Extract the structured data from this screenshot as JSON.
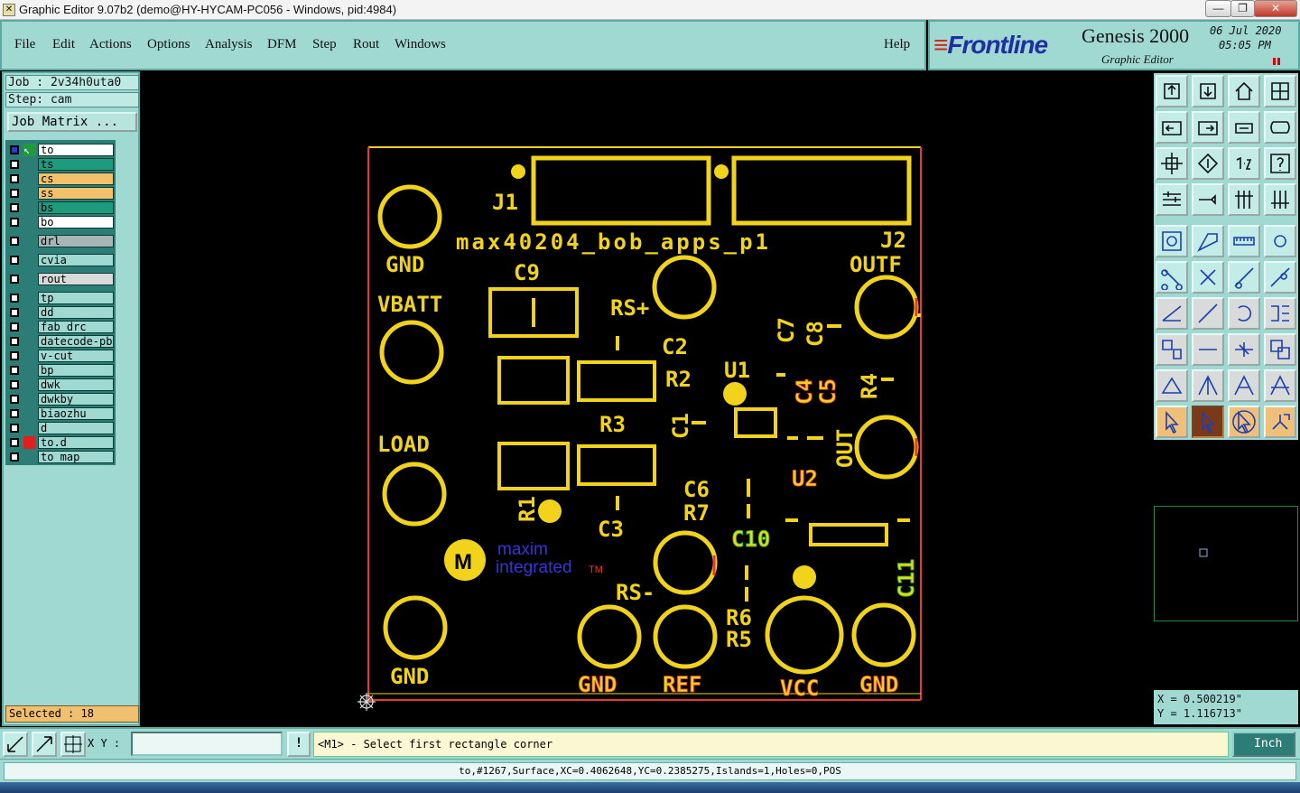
{
  "window": {
    "title": "Graphic Editor 9.07b2 (demo@HY-HYCAM-PC056 - Windows, pid:4984)",
    "min": "—",
    "max": "❐",
    "close": "✕"
  },
  "menu": {
    "items": [
      "File",
      "Edit",
      "Actions",
      "Options",
      "Analysis",
      "DFM",
      "Step",
      "Rout",
      "Windows"
    ],
    "help": "Help"
  },
  "brand": {
    "logo_pre": "≡",
    "logo": "Frontline",
    "product": "Genesis 2000",
    "subtitle": "Graphic Editor",
    "date": "06 Jul 2020",
    "time": "05:05 PM"
  },
  "left": {
    "job": "Job : 2v34h0uta0",
    "step": "Step: cam",
    "job_matrix": "Job Matrix ...",
    "selected": "Selected : 18",
    "layers": [
      {
        "name": "to",
        "color": "#ffffff",
        "active": true
      },
      {
        "name": "ts",
        "color": "#1e9a7c"
      },
      {
        "name": "cs",
        "color": "#f3c06b"
      },
      {
        "name": "ss",
        "color": "#f3c06b"
      },
      {
        "name": "bs",
        "color": "#1e9a7c"
      },
      {
        "name": "bo",
        "color": "#ffffff"
      },
      {
        "name": "drl",
        "color": "#a9b4b4"
      },
      {
        "name": "cvia",
        "color": "#9fd9d2"
      },
      {
        "name": "rout",
        "color": "#d9d9d9"
      },
      {
        "name": "tp",
        "color": "#9fd9d2"
      },
      {
        "name": "dd",
        "color": "#9fd9d2"
      },
      {
        "name": "fab_drc",
        "color": "#9fd9d2"
      },
      {
        "name": "datecode-pbc",
        "color": "#9fd9d2"
      },
      {
        "name": "v-cut",
        "color": "#9fd9d2"
      },
      {
        "name": "bp",
        "color": "#9fd9d2"
      },
      {
        "name": "dwk",
        "color": "#9fd9d2"
      },
      {
        "name": "dwkby",
        "color": "#9fd9d2"
      },
      {
        "name": "biaozhu",
        "color": "#9fd9d2"
      },
      {
        "name": "d",
        "color": "#9fd9d2"
      },
      {
        "name": "to.d",
        "color": "#9fd9d2",
        "marker": "#e02020"
      },
      {
        "name": "to_map",
        "color": "#9fd9d2"
      }
    ]
  },
  "board": {
    "labels": {
      "j1": "J1",
      "j2": "J2",
      "title": "max40204_bob_apps_p1",
      "gnd_tl": "GND",
      "vbatt": "VBATT",
      "load": "LOAD",
      "gnd_bl": "GND",
      "outf": "OUTF",
      "c9": "C9",
      "rsp": "RS+",
      "c2": "C2",
      "r2": "R2",
      "r3": "R3",
      "r1": "R1",
      "c3": "C3",
      "c1": "C1",
      "u1": "U1",
      "c6": "C6",
      "r7": "R7",
      "c7": "C7",
      "c8": "C8",
      "c4": "C4",
      "c5": "C5",
      "r4": "R4",
      "out": "OUT",
      "u2": "U2",
      "c10": "C10",
      "c11": "C11",
      "rsm": "RS-",
      "r6": "R6",
      "r5": "R5",
      "gnd1": "GND",
      "ref": "REF",
      "vcc": "VCC",
      "gnd2": "GND",
      "maxim1": "maxim",
      "maxim2": "integrated",
      "tm": "TM"
    }
  },
  "coords": {
    "x": "X = 0.500219\"",
    "y": "Y = 1.116713\""
  },
  "bottom": {
    "xy_label": "X Y :",
    "xy_value": "",
    "alert": "!",
    "prompt": "<M1> - Select first rectangle corner",
    "unit": "Inch"
  },
  "status": "to,#1267,Surface,XC=0.4062648,YC=0.2385275,Islands=1,Holes=0,POS",
  "colors": {
    "panel": "#9fd9d2",
    "panel_border": "#5da9a1",
    "pcb_yellow": "#f1d31b",
    "pcb_red": "#e63a2e",
    "pcb_green": "#2bb62b"
  }
}
